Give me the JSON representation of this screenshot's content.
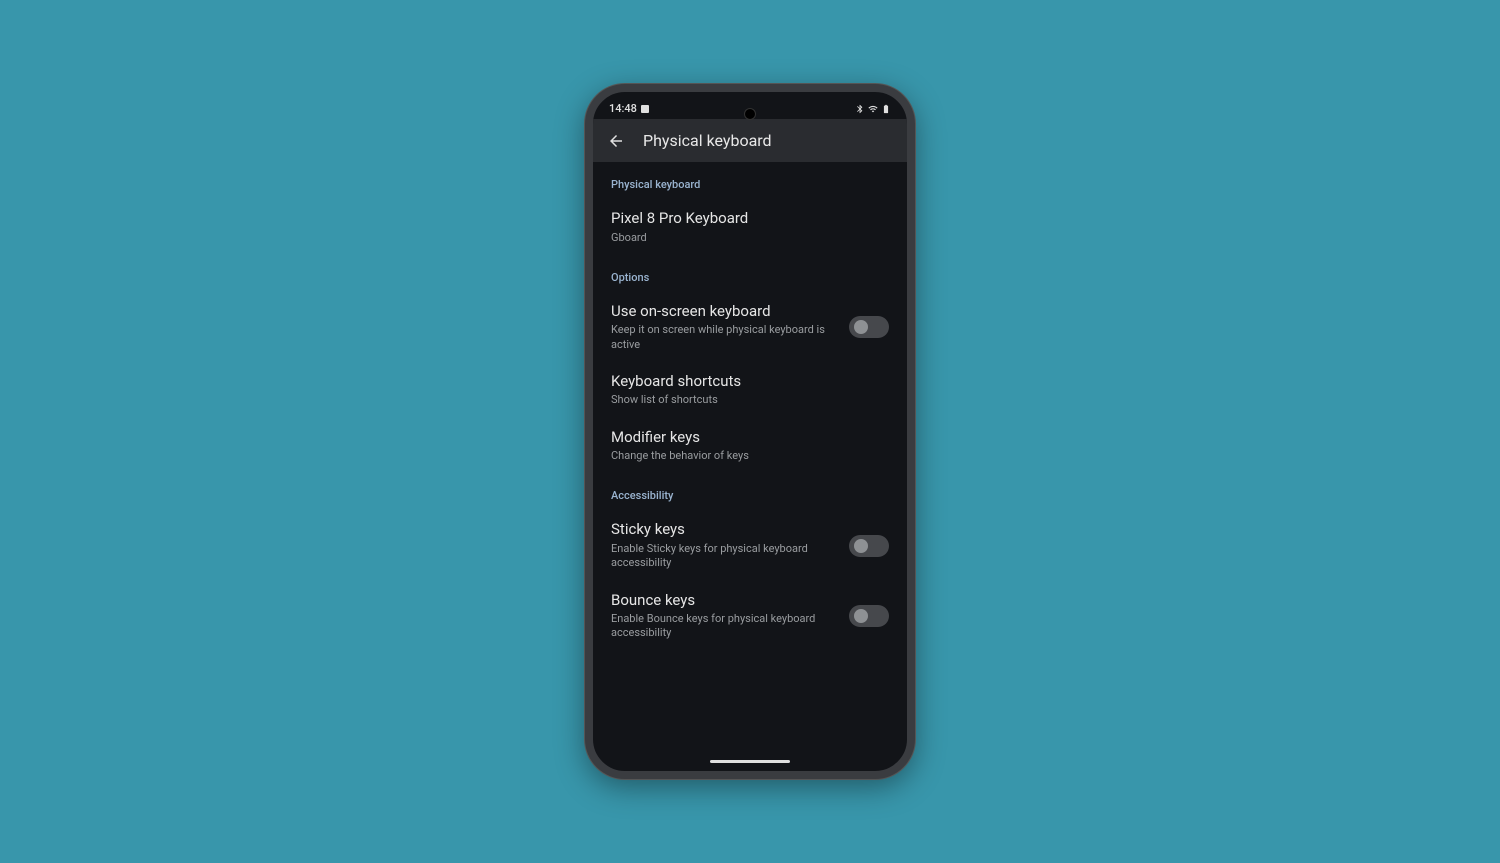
{
  "statusBar": {
    "time": "14:48"
  },
  "appBar": {
    "title": "Physical keyboard"
  },
  "sections": {
    "physicalKeyboard": {
      "header": "Physical keyboard",
      "device": {
        "title": "Pixel 8 Pro Keyboard",
        "subtitle": "Gboard"
      }
    },
    "options": {
      "header": "Options",
      "onScreen": {
        "title": "Use on-screen keyboard",
        "subtitle": "Keep it on screen while physical keyboard is active"
      },
      "shortcuts": {
        "title": "Keyboard shortcuts",
        "subtitle": "Show list of shortcuts"
      },
      "modifier": {
        "title": "Modifier keys",
        "subtitle": "Change the behavior of keys"
      }
    },
    "accessibility": {
      "header": "Accessibility",
      "sticky": {
        "title": "Sticky keys",
        "subtitle": "Enable Sticky keys for physical keyboard accessibility"
      },
      "bounce": {
        "title": "Bounce keys",
        "subtitle": "Enable Bounce keys for physical keyboard accessibility"
      }
    }
  }
}
